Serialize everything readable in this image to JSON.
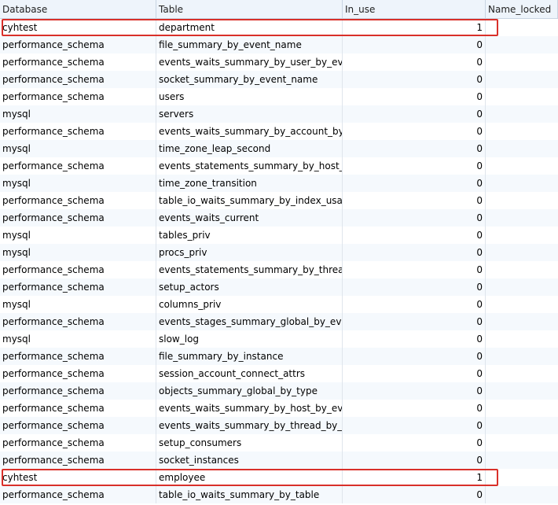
{
  "columns": [
    "Database",
    "Table",
    "In_use",
    "Name_locked"
  ],
  "rows": [
    {
      "db": "cyhtest",
      "table": "department",
      "in_use": "1",
      "name_locked": ""
    },
    {
      "db": "performance_schema",
      "table": "file_summary_by_event_name",
      "in_use": "0",
      "name_locked": ""
    },
    {
      "db": "performance_schema",
      "table": "events_waits_summary_by_user_by_event",
      "in_use": "0",
      "name_locked": ""
    },
    {
      "db": "performance_schema",
      "table": "socket_summary_by_event_name",
      "in_use": "0",
      "name_locked": ""
    },
    {
      "db": "performance_schema",
      "table": "users",
      "in_use": "0",
      "name_locked": ""
    },
    {
      "db": "mysql",
      "table": "servers",
      "in_use": "0",
      "name_locked": ""
    },
    {
      "db": "performance_schema",
      "table": "events_waits_summary_by_account_by_ev",
      "in_use": "0",
      "name_locked": ""
    },
    {
      "db": "mysql",
      "table": "time_zone_leap_second",
      "in_use": "0",
      "name_locked": ""
    },
    {
      "db": "performance_schema",
      "table": "events_statements_summary_by_host_by_",
      "in_use": "0",
      "name_locked": ""
    },
    {
      "db": "mysql",
      "table": "time_zone_transition",
      "in_use": "0",
      "name_locked": ""
    },
    {
      "db": "performance_schema",
      "table": "table_io_waits_summary_by_index_usage",
      "in_use": "0",
      "name_locked": ""
    },
    {
      "db": "performance_schema",
      "table": "events_waits_current",
      "in_use": "0",
      "name_locked": ""
    },
    {
      "db": "mysql",
      "table": "tables_priv",
      "in_use": "0",
      "name_locked": ""
    },
    {
      "db": "mysql",
      "table": "procs_priv",
      "in_use": "0",
      "name_locked": ""
    },
    {
      "db": "performance_schema",
      "table": "events_statements_summary_by_thread_b",
      "in_use": "0",
      "name_locked": ""
    },
    {
      "db": "performance_schema",
      "table": "setup_actors",
      "in_use": "0",
      "name_locked": ""
    },
    {
      "db": "mysql",
      "table": "columns_priv",
      "in_use": "0",
      "name_locked": ""
    },
    {
      "db": "performance_schema",
      "table": "events_stages_summary_global_by_event",
      "in_use": "0",
      "name_locked": ""
    },
    {
      "db": "mysql",
      "table": "slow_log",
      "in_use": "0",
      "name_locked": ""
    },
    {
      "db": "performance_schema",
      "table": "file_summary_by_instance",
      "in_use": "0",
      "name_locked": ""
    },
    {
      "db": "performance_schema",
      "table": "session_account_connect_attrs",
      "in_use": "0",
      "name_locked": ""
    },
    {
      "db": "performance_schema",
      "table": "objects_summary_global_by_type",
      "in_use": "0",
      "name_locked": ""
    },
    {
      "db": "performance_schema",
      "table": "events_waits_summary_by_host_by_event",
      "in_use": "0",
      "name_locked": ""
    },
    {
      "db": "performance_schema",
      "table": "events_waits_summary_by_thread_by_eve",
      "in_use": "0",
      "name_locked": ""
    },
    {
      "db": "performance_schema",
      "table": "setup_consumers",
      "in_use": "0",
      "name_locked": ""
    },
    {
      "db": "performance_schema",
      "table": "socket_instances",
      "in_use": "0",
      "name_locked": ""
    },
    {
      "db": "cyhtest",
      "table": "employee",
      "in_use": "1",
      "name_locked": ""
    },
    {
      "db": "performance_schema",
      "table": "table_io_waits_summary_by_table",
      "in_use": "0",
      "name_locked": ""
    }
  ],
  "highlighted_rows": [
    0,
    26
  ],
  "highlight_color": "#d9302a"
}
